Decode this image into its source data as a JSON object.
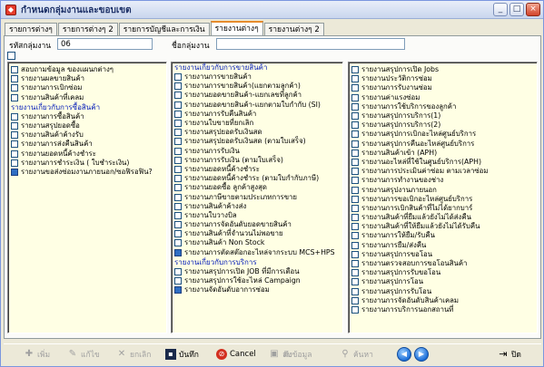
{
  "window": {
    "title": "กำหนดกลุ่มงานและขอบเขต",
    "icon": "app-icon",
    "controls": [
      "_",
      "□",
      "×"
    ]
  },
  "tabs": [
    "รายการต่างๆ",
    "รายการต่างๆ 2",
    "รายการบัญชีและการเงิน",
    "รายงานต่างๆ",
    "รายงานต่างๆ 2"
  ],
  "active_tab": "รายงานต่างๆ",
  "form": {
    "group_code_label": "รหัสกลุ่มงาน",
    "group_code_value": "06",
    "group_name_label": "ชื่อกลุ่มงาน",
    "group_name_value": ""
  },
  "col1": {
    "items_top": [
      {
        "label": "สอบถามข้อมูล ของแผนกต่างๆ",
        "checked": false
      },
      {
        "label": "รายงานผลขายสินค้า",
        "checked": false
      },
      {
        "label": "รายงานการเบิกซ่อม",
        "checked": false
      },
      {
        "label": "รายงานสินค้าที่เคลม",
        "checked": false
      }
    ],
    "section": "รายงานเกี่ยวกับการซื้อสินค้า",
    "items_section": [
      {
        "label": "รายงานการซื้อสินค้า",
        "checked": false
      },
      {
        "label": "รายงานสรุปยอดซื้อ",
        "checked": false
      },
      {
        "label": "รายงานสินค้าค้างรับ",
        "checked": false
      },
      {
        "label": "รายงานการส่งคืนสินค้า",
        "checked": false
      },
      {
        "label": "รายงานยอดหนี้ค้างชำระ",
        "checked": false
      },
      {
        "label": "รายงานการชำระเงิน ( ใบชำระเงิน)",
        "checked": false
      },
      {
        "label": "รายงานขอส่งซ่อมงานภายนอก/ซอฟิรอฟิน?",
        "checked": true
      }
    ]
  },
  "col2": {
    "section1": "รายงานเกี่ยวกับการขายสินค้า",
    "items1": [
      {
        "label": "รายงานการขายสินค้า",
        "checked": false
      },
      {
        "label": "รายงานการขายสินค้า(แยกตามลูกค้า)",
        "checked": false
      },
      {
        "label": "รายงานยอดขายสินค้า-แยกเลขที่ลูกค้า",
        "checked": false
      },
      {
        "label": "รายงานยอดขายสินค้า-แยกตามใบกำกับ (SI)",
        "checked": false
      },
      {
        "label": "รายงานการรับคืนสินค้า",
        "checked": false
      },
      {
        "label": "รายงานใบขายที่ยกเลิก",
        "checked": false
      },
      {
        "label": "รายงานสรุปยอดรับเงินสด",
        "checked": false
      },
      {
        "label": "รายงานสรุปยอดรับเงินสด (ตามใบเสร็จ)",
        "checked": false
      },
      {
        "label": "รายงานการรับเงิน",
        "checked": false
      },
      {
        "label": "รายงานการรับเงิน (ตามใบเสร็จ)",
        "checked": false
      },
      {
        "label": "รายงานยอดหนี้ค้างชำระ",
        "checked": false
      },
      {
        "label": "รายงานยอดหนี้ค้างชำระ (ตามใบกำกับภาษี)",
        "checked": false
      },
      {
        "label": "รายงานยอดซื้อ ลูกค้าสูงสุด",
        "checked": false
      },
      {
        "label": "รายงานภาษีขายตามประเภทการขาย",
        "checked": false
      },
      {
        "label": "รายงานสินค้าค้างส่ง",
        "checked": false
      },
      {
        "label": "รายงานใบวางบิล",
        "checked": false
      },
      {
        "label": "รายงานการจัดอันดับยอดขายสินค้า",
        "checked": false
      },
      {
        "label": "รายงานสินค้าที่จำนวนไม่พอขาย",
        "checked": false
      },
      {
        "label": "รายงานสินค้า Non Stock",
        "checked": false
      },
      {
        "label": "รายงานการตัดสต๊อกอะไหล่จากระบบ MCS+HPS",
        "checked": true
      }
    ],
    "section2": "รายงานเกี่ยวกับการบริการ",
    "items2": [
      {
        "label": "รายงานสรุปการเปิด JOB ที่มีการเตือน",
        "checked": false
      },
      {
        "label": "รายงานสรุปการใช้อะไหล่ Campaign",
        "checked": false
      },
      {
        "label": "รายงานจัดอันดับอาการซ่อม",
        "checked": true
      }
    ]
  },
  "col3": {
    "items": [
      {
        "label": "รายงานสรุปการเปิด Jobs",
        "checked": false
      },
      {
        "label": "รายงานประวัติการซ่อม",
        "checked": false
      },
      {
        "label": "รายงานการรับงานซ่อม",
        "checked": false
      },
      {
        "label": "รายงานค่าแรงซ่อม",
        "checked": false
      },
      {
        "label": "รายงานการใช้บริการของลูกค้า",
        "checked": false
      },
      {
        "label": "รายงานสรุปการบริการ(1)",
        "checked": false
      },
      {
        "label": "รายงานสรุปการบริการ(2)",
        "checked": false
      },
      {
        "label": "รายงานสรุปการเบิกอะไหล่ศูนย์บริการ",
        "checked": false
      },
      {
        "label": "รายงานสรุปการคืนอะไหล่ศูนย์บริการ",
        "checked": false
      },
      {
        "label": "รายงานสินค้าเข้า (APH)",
        "checked": false
      },
      {
        "label": "รายงานอะไหล่ที่ใช้ในศูนย์บริการ(APH)",
        "checked": false
      },
      {
        "label": "รายงานการประเมินค่าซ่อม ตามเวลาซ่อม",
        "checked": false
      },
      {
        "label": "รายงานการทำงานของช่าง",
        "checked": false
      },
      {
        "label": "รายงานสรุปงานภายนอก",
        "checked": false
      },
      {
        "label": "รายงานการขอเบิกอะไหล่ศูนย์บริการ",
        "checked": false
      },
      {
        "label": "รายงานการเบิกสินค้าที่ไม่ได้ยากบาร์",
        "checked": false
      },
      {
        "label": "รายงานสินค้าที่ยืมแล้วยังไม่ได้ส่งคืน",
        "checked": false
      },
      {
        "label": "รายงานสินค้าที่ให้ยืมแล้วยังไม่ได้รับคืน",
        "checked": false
      },
      {
        "label": "รายงานการให้ยืม/รับคืน",
        "checked": false
      },
      {
        "label": "รายงานการยืม/ส่งคืน",
        "checked": false
      },
      {
        "label": "รายงานสรุปการขอโอน",
        "checked": false
      },
      {
        "label": "รายงานตรวจสอบการขอโอนสินค้า",
        "checked": false
      },
      {
        "label": "รายงานสรุปการรับขอโอน",
        "checked": false
      },
      {
        "label": "รายงานสรุปการโอน",
        "checked": false
      },
      {
        "label": "รายงานสรุปการรับโอน",
        "checked": false
      },
      {
        "label": "รายงานการจัดอันดับสินค้าเคลม",
        "checked": false
      },
      {
        "label": "รายงานการบริการนอกสถานที่",
        "checked": false
      }
    ]
  },
  "toolbar": {
    "add": "เพิ่ม",
    "edit": "แก้ไข",
    "cancel_record": "ยกเลิก",
    "save": "บันทึก",
    "cancel": "Cancel",
    "delete": "ลบ",
    "print_data": "ดึงข้อมูล",
    "search": "ค้นหา",
    "close": "ปิด"
  }
}
